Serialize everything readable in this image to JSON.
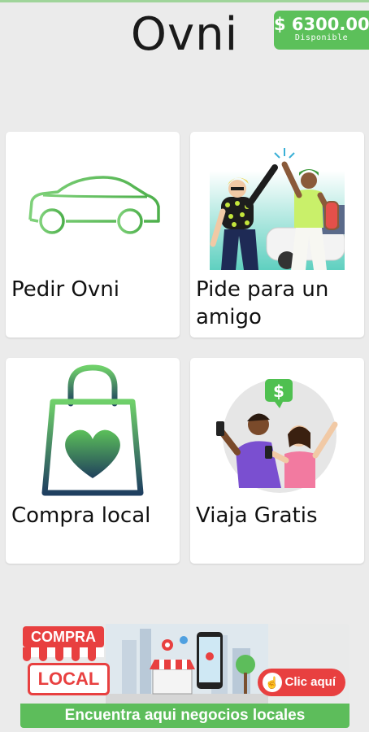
{
  "header": {
    "title": "Ovni",
    "balance_amount": "$ 6300.00",
    "balance_label": "Disponible"
  },
  "cards": [
    {
      "label": "Pedir Ovni",
      "icon": "car-icon"
    },
    {
      "label": "Pide para un amigo",
      "icon": "high-five-illustration"
    },
    {
      "label": "Compra local",
      "icon": "shopping-bag-heart-icon"
    },
    {
      "label": "Viaja Gratis",
      "icon": "people-phones-money-illustration"
    }
  ],
  "banner": {
    "tag_top": "COMPRA",
    "tag_bottom": "LOCAL",
    "button": "Clic aquí",
    "text": "Encuentra aqui negocios locales"
  },
  "colors": {
    "accent_green": "#5cc05a",
    "banner_red": "#e84040",
    "background": "#ebebeb"
  }
}
